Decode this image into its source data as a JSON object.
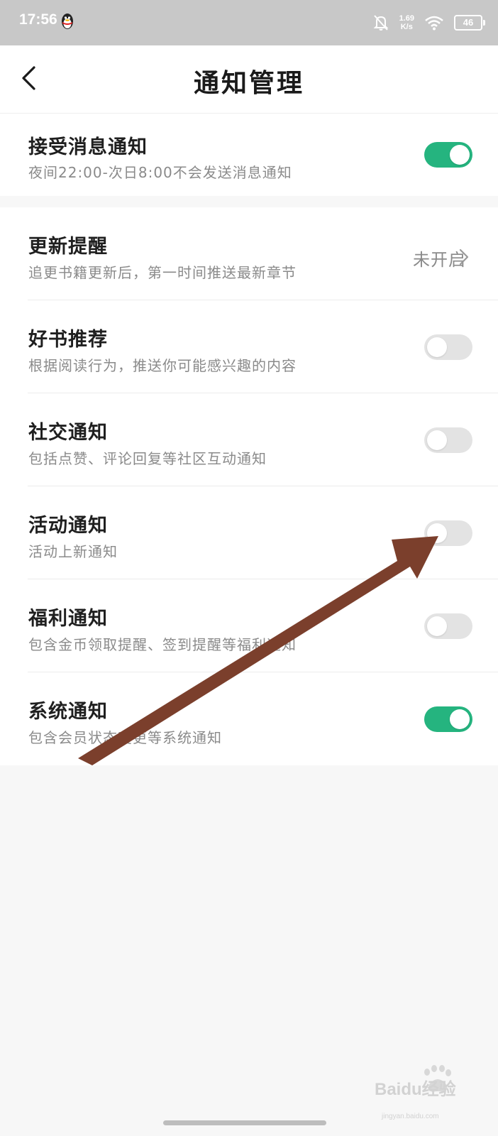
{
  "status_bar": {
    "time": "17:56",
    "speed_value": "1.69",
    "speed_unit": "K/s",
    "battery": "46",
    "icons": [
      "qq-icon",
      "mute-bell-icon",
      "wifi-icon",
      "battery-icon"
    ]
  },
  "header": {
    "title": "通知管理",
    "back_icon": "chevron-left-icon"
  },
  "main_toggle": {
    "title": "接受消息通知",
    "subtitle": "夜间22:00-次日8:00不会发送消息通知",
    "enabled": true
  },
  "settings": [
    {
      "title": "更新提醒",
      "subtitle": "追更书籍更新后，第一时间推送最新章节",
      "value": "未开启",
      "type": "link"
    },
    {
      "title": "好书推荐",
      "subtitle": "根据阅读行为，推送你可能感兴趣的内容",
      "type": "toggle",
      "enabled": false
    },
    {
      "title": "社交通知",
      "subtitle": "包括点赞、评论回复等社区互动通知",
      "type": "toggle",
      "enabled": false
    },
    {
      "title": "活动通知",
      "subtitle": "活动上新通知",
      "type": "toggle",
      "enabled": false
    },
    {
      "title": "福利通知",
      "subtitle": "包含金币领取提醒、签到提醒等福利通知",
      "type": "toggle",
      "enabled": false
    },
    {
      "title": "系统通知",
      "subtitle": "包含会员状态变更等系统通知",
      "type": "toggle",
      "enabled": true
    }
  ],
  "colors": {
    "toggle_on": "#25b47f",
    "toggle_off": "#e3e3e3",
    "annotation_arrow": "#7b3f2c"
  },
  "watermark": {
    "text": "Baidu经验",
    "sub": "jingyan.baidu.com"
  }
}
